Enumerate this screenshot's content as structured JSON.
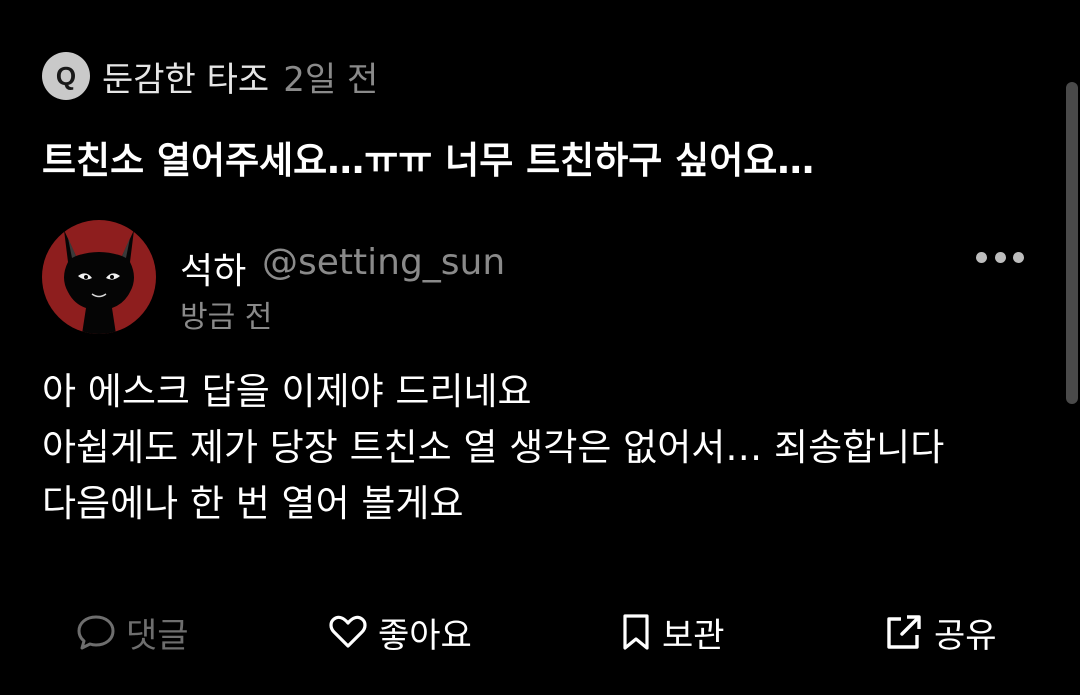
{
  "question": {
    "badge": "Q",
    "asker": "둔감한 타조",
    "time": "2일 전",
    "text": "트친소 열어주세요…ㅠㅠ 너무 트친하구 싶어요…"
  },
  "answer": {
    "author_name": "석하",
    "author_handle": "@setting_sun",
    "time": "방금 전",
    "lines": [
      "아 에스크 답을 이제야 드리네요",
      "아쉽게도 제가 당장 트친소 열 생각은 없어서… 죄송합니다",
      "다음에나 한 번 열어 볼게요"
    ]
  },
  "actions": {
    "comment": "댓글",
    "like": "좋아요",
    "save": "보관",
    "share": "공유"
  },
  "colors": {
    "background": "#000000",
    "avatar_bg": "#8e1e1e",
    "muted_text": "#8a8a8a",
    "disabled_action": "#6e6e6e"
  },
  "icons": {
    "question_badge": "q-badge-icon",
    "avatar": "black-cat-avatar",
    "more": "more-dots-icon",
    "comment": "speech-bubble-icon",
    "like": "heart-icon",
    "save": "bookmark-icon",
    "share": "share-external-icon"
  }
}
